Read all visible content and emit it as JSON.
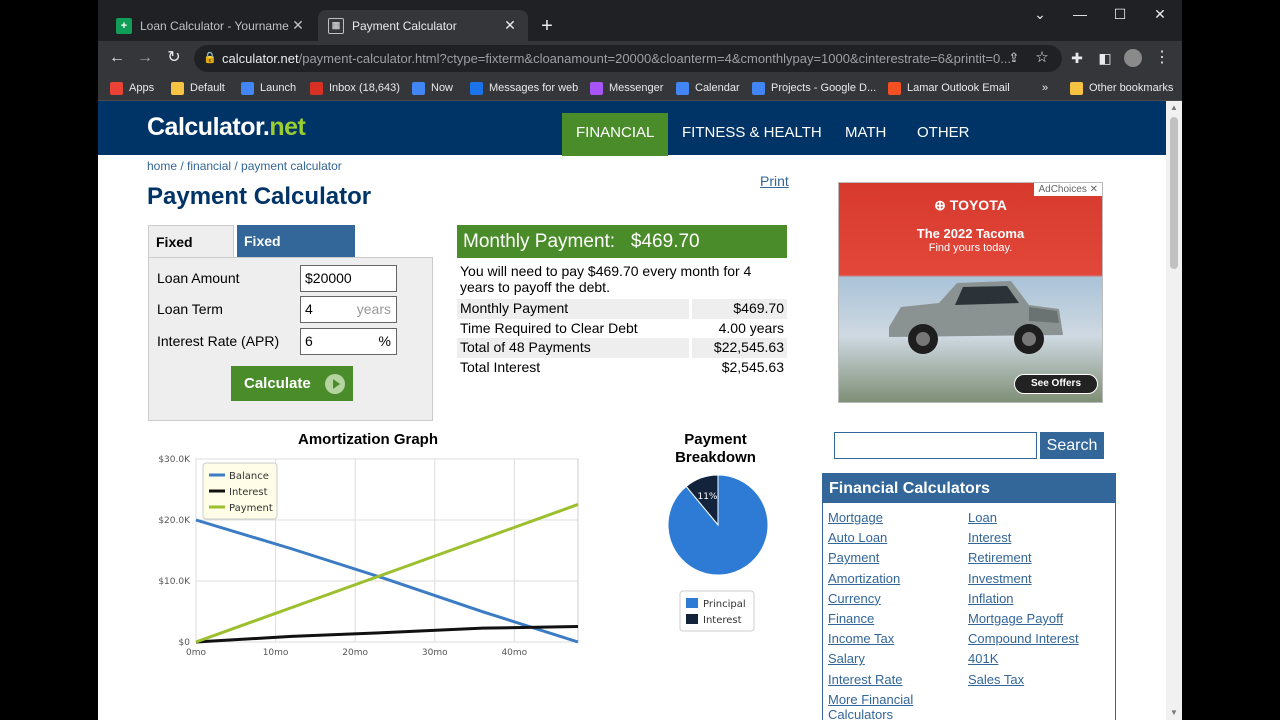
{
  "browser": {
    "tabs": [
      {
        "label": "Loan Calculator - Yourname - Go",
        "favicon": "google-sheets-icon",
        "active": false
      },
      {
        "label": "Payment Calculator",
        "favicon": "calculator-icon",
        "active": true
      }
    ],
    "url_host": "calculator.net",
    "url_path": "/payment-calculator.html?ctype=fixterm&cloanamount=20000&cloanterm=4&cmonthlypay=1000&cinterestrate=6&printit=0...",
    "bookmarks": [
      {
        "label": "Apps",
        "color": "#ea4335"
      },
      {
        "label": "Default",
        "color": "#f6c343"
      },
      {
        "label": "Launch",
        "color": "#4285f4"
      },
      {
        "label": "Inbox (18,643)",
        "color": "#d93025"
      },
      {
        "label": "Now",
        "color": "#4285f4"
      },
      {
        "label": "Messages for web",
        "color": "#1a73e8"
      },
      {
        "label": "Messenger",
        "color": "#a855f7"
      },
      {
        "label": "Calendar",
        "color": "#4285f4"
      },
      {
        "label": "Projects - Google D...",
        "color": "#4285f4"
      },
      {
        "label": "Lamar Outlook Email",
        "color": "#f25022"
      },
      {
        "label": "»",
        "color": ""
      },
      {
        "label": "Other bookmarks",
        "color": "#f6c343"
      }
    ]
  },
  "site": {
    "logo_main": "Calculator.",
    "logo_net": "net",
    "nav": [
      "FINANCIAL",
      "FITNESS & HEALTH",
      "MATH",
      "OTHER"
    ],
    "breadcrumb": "home / financial / payment calculator",
    "title": "Payment Calculator",
    "print": "Print"
  },
  "form": {
    "tab_fixed_term": "Fixed Term",
    "tab_fixed_payments": "Fixed Payments",
    "loan_amount_label": "Loan Amount",
    "loan_amount_value": "$20000",
    "loan_term_label": "Loan Term",
    "loan_term_value": "4",
    "loan_term_unit": "years",
    "rate_label": "Interest Rate (APR)",
    "rate_value": "6",
    "rate_unit": "%",
    "calculate": "Calculate"
  },
  "result": {
    "heading_label": "Monthly Payment:",
    "heading_value": "$469.70",
    "description": "You will need to pay $469.70 every month for 4 years to payoff the debt.",
    "rows": [
      {
        "label": "Monthly Payment",
        "value": "$469.70"
      },
      {
        "label": "Time Required to Clear Debt",
        "value": "4.00 years"
      },
      {
        "label": "Total of 48 Payments",
        "value": "$22,545.63"
      },
      {
        "label": "Total Interest",
        "value": "$2,545.63"
      }
    ]
  },
  "chart_data": [
    {
      "type": "line",
      "title": "Amortization Graph",
      "xlabel": "",
      "ylabel": "",
      "x": [
        0,
        48
      ],
      "x_ticks": [
        "0mo",
        "10mo",
        "20mo",
        "30mo",
        "40mo"
      ],
      "x_tick_values": [
        0,
        10,
        20,
        30,
        40
      ],
      "y_ticks": [
        "$0",
        "$10.0K",
        "$20.0K",
        "$30.0K"
      ],
      "y_tick_values": [
        0,
        10000,
        20000,
        30000
      ],
      "xlim": [
        0,
        48
      ],
      "ylim": [
        0,
        30000
      ],
      "grid": true,
      "legend_position": "top-left",
      "series": [
        {
          "name": "Balance",
          "color": "#3b7cc4",
          "x": [
            0,
            12,
            24,
            36,
            48
          ],
          "values": [
            20000,
            15287,
            10284,
            4973,
            0
          ]
        },
        {
          "name": "Interest",
          "color": "#111111",
          "x": [
            0,
            12,
            24,
            36,
            48
          ],
          "values": [
            0,
            923,
            1556,
            2265,
            2546
          ]
        },
        {
          "name": "Payment",
          "color": "#9cbf2e",
          "x": [
            0,
            12,
            24,
            36,
            48
          ],
          "values": [
            0,
            5636,
            11273,
            16909,
            22546
          ]
        }
      ]
    },
    {
      "type": "pie",
      "title": "Payment Breakdown",
      "legend_position": "bottom",
      "categories": [
        "Principal",
        "Interest"
      ],
      "values": [
        89,
        11
      ],
      "labels": [
        "89%",
        "11%"
      ],
      "colors": [
        "#2e7bd6",
        "#13233b"
      ]
    }
  ],
  "ad": {
    "adchoices": "AdChoices",
    "brand": "TOYOTA",
    "headline": "The 2022 Tacoma",
    "subline": "Find yours today.",
    "cta": "See Offers"
  },
  "sidebar": {
    "search_button": "Search",
    "heading": "Financial Calculators",
    "links_left": [
      "Mortgage",
      "Auto Loan",
      "Payment",
      "Amortization",
      "Currency",
      "Finance",
      "Income Tax",
      "Salary",
      "Interest Rate",
      "More Financial Calculators"
    ],
    "links_right": [
      "Loan",
      "Interest",
      "Retirement",
      "Investment",
      "Inflation",
      "Mortgage Payoff",
      "Compound Interest",
      "401K",
      "Sales Tax"
    ]
  }
}
